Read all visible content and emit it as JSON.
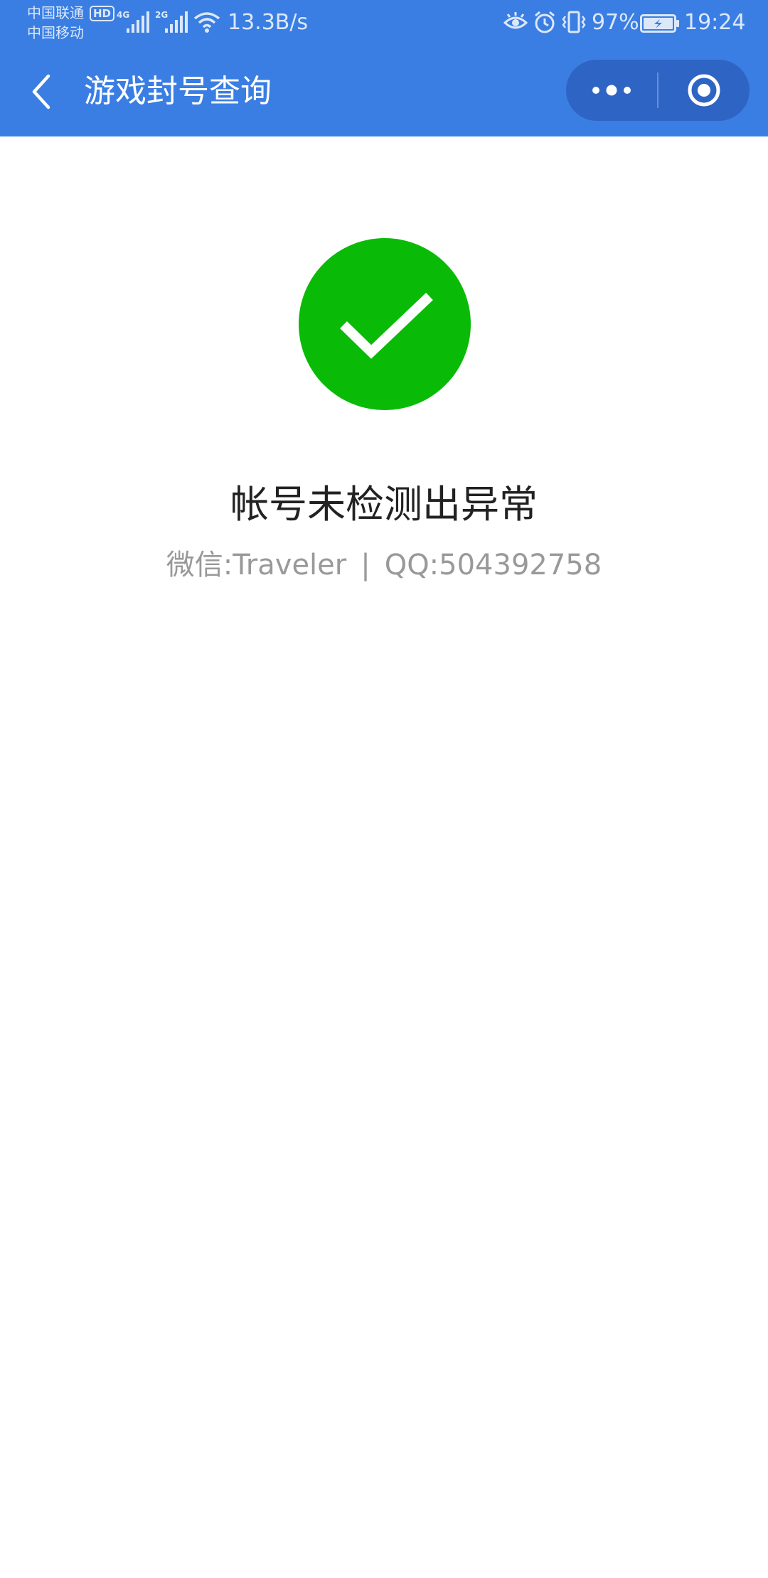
{
  "status_bar": {
    "carrier_1": "中国联通",
    "carrier_2": "中国移动",
    "hd_badge": "HD",
    "net_type_1": "4G",
    "net_type_2": "2G",
    "net_speed": "13.3B/s",
    "battery_percent": "97%",
    "time": "19:24",
    "icons": [
      "signal-icon",
      "wifi-icon",
      "eye-icon",
      "alarm-icon",
      "vibrate-icon",
      "battery-charging-icon"
    ]
  },
  "nav": {
    "title": "游戏封号查询",
    "back_icon": "chevron-left-icon",
    "more_icon": "more-dots-icon",
    "close_icon": "target-circle-icon"
  },
  "result": {
    "icon": "success-check-icon",
    "title": "帐号未检测出异常",
    "wechat_label": "微信:Traveler",
    "separator": "|",
    "qq_label": "QQ:504392758"
  },
  "colors": {
    "header_bg": "#3a7ee3",
    "capsule_bg": "#2e64c4",
    "success_green": "#09bb07",
    "title_text": "#222222",
    "secondary_text": "#999999"
  }
}
